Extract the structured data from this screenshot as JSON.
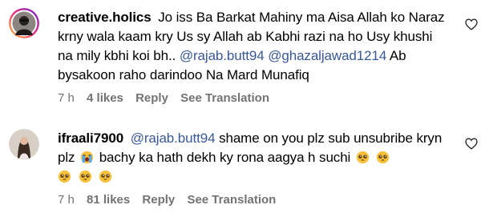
{
  "comments": [
    {
      "username": "creative.holics",
      "text_1": "Jo iss Ba Barkat Mahiny ma Aisa Allah ko Naraz krny wala kaam kry Us sy Allah ab Kabhi razi na ho Usy khushi na mily kbhi koi bh..",
      "mention_1": "@rajab.butt94",
      "mention_2": "@ghazaljawad1214",
      "text_2": "Ab bysakoon raho darindoo Na Mard Munafiq",
      "time": "7 h",
      "likes": "4 likes",
      "reply_label": "Reply",
      "translate_label": "See Translation"
    },
    {
      "username": "ifraali7900",
      "mention_1": "@rajab.butt94",
      "text_1": "shame on you plz sub unsubribe kryn plz",
      "text_2": "bachy ka hath dekh ky rona aagya h suchi",
      "time": "7 h",
      "likes": "81 likes",
      "reply_label": "Reply",
      "translate_label": "See Translation"
    }
  ],
  "icons": {
    "like": "heart-outline-icon",
    "emoji_crying": "loudly-crying-face-emoji",
    "emoji_pleading": "pleading-face-emoji"
  },
  "colors": {
    "mention": "#385898",
    "meta": "#737373",
    "emoji": "#f7c13b"
  }
}
